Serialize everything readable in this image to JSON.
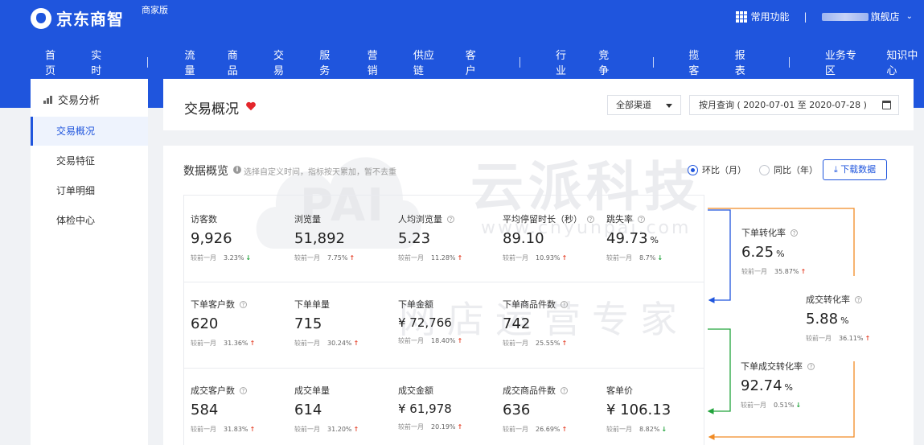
{
  "brand": {
    "name": "京东商智",
    "edition": "商家版"
  },
  "topRight": {
    "apps_label": "常用功能",
    "divider": "|",
    "store_label": "旗舰店"
  },
  "nav": {
    "items": [
      "首页",
      "实时",
      "流量",
      "商品",
      "交易",
      "服务",
      "营销",
      "供应链",
      "客户",
      "行业",
      "竞争",
      "揽客",
      "报表",
      "业务专区",
      "知识中心"
    ],
    "active": "交易"
  },
  "sidebar": {
    "title": "交易分析",
    "items": [
      "交易概况",
      "交易特征",
      "订单明细",
      "体检中心"
    ],
    "active": "交易概况"
  },
  "header": {
    "title": "交易概况",
    "channel": "全部渠道",
    "date_range": "按月查询 ( 2020-07-01 至 2020-07-28 )"
  },
  "overview": {
    "title": "数据概览",
    "hint": "选择自定义时间，指标按天累加，暂不去重",
    "radio_mom": "环比（月）",
    "radio_yoy": "同比（年）",
    "selected": "环比（月）",
    "download": "下载数据",
    "compare_label": "较前一月"
  },
  "watermark": {
    "brand": "云派科技",
    "domain": "www.cnyunpai.com",
    "slogan": "网店运营专家",
    "logo": "PAI"
  },
  "metrics": [
    {
      "label": "访客数",
      "value": "9,926",
      "unit": "",
      "pct": "3.23%",
      "trend": "down",
      "help": false
    },
    {
      "label": "浏览量",
      "value": "51,892",
      "unit": "",
      "pct": "7.75%",
      "trend": "up",
      "help": false
    },
    {
      "label": "人均浏览量",
      "value": "5.23",
      "unit": "",
      "pct": "11.28%",
      "trend": "up",
      "help": true
    },
    {
      "label": "平均停留时长（秒）",
      "value": "89.10",
      "unit": "",
      "pct": "10.93%",
      "trend": "up",
      "help": true
    },
    {
      "label": "跳失率",
      "value": "49.73",
      "unit": "%",
      "pct": "8.7%",
      "trend": "down",
      "help": true
    },
    {
      "label": "下单客户数",
      "value": "620",
      "unit": "",
      "pct": "31.36%",
      "trend": "up",
      "help": true
    },
    {
      "label": "下单单量",
      "value": "715",
      "unit": "",
      "pct": "30.24%",
      "trend": "up",
      "help": false
    },
    {
      "label": "下单金额",
      "value": "¥ 72,766",
      "unit": "",
      "pct": "18.40%",
      "trend": "up",
      "help": false,
      "money": true
    },
    {
      "label": "下单商品件数",
      "value": "742",
      "unit": "",
      "pct": "25.55%",
      "trend": "up",
      "help": true
    },
    {
      "label": "成交客户数",
      "value": "584",
      "unit": "",
      "pct": "31.83%",
      "trend": "up",
      "help": true
    },
    {
      "label": "成交单量",
      "value": "614",
      "unit": "",
      "pct": "31.20%",
      "trend": "up",
      "help": false
    },
    {
      "label": "成交金额",
      "value": "¥ 61,978",
      "unit": "",
      "pct": "20.19%",
      "trend": "up",
      "help": false,
      "money": true
    },
    {
      "label": "成交商品件数",
      "value": "636",
      "unit": "",
      "pct": "26.69%",
      "trend": "up",
      "help": true
    },
    {
      "label": "客单价",
      "value": "¥ 106.13",
      "unit": "",
      "pct": "8.82%",
      "trend": "down",
      "help": false
    }
  ],
  "conversions": [
    {
      "label": "下单转化率",
      "value": "6.25",
      "unit": "%",
      "pct": "35.87%",
      "trend": "up"
    },
    {
      "label": "成交转化率",
      "value": "5.88",
      "unit": "%",
      "pct": "36.11%",
      "trend": "up"
    },
    {
      "label": "下单成交转化率",
      "value": "92.74",
      "unit": "%",
      "pct": "0.51%",
      "trend": "down"
    }
  ],
  "colors": {
    "primary": "#1f55dd",
    "up": "#e64a33",
    "down": "#21a33b",
    "flow_blue": "#1f55dd",
    "flow_green": "#21a33b",
    "flow_orange": "#f08a24"
  }
}
